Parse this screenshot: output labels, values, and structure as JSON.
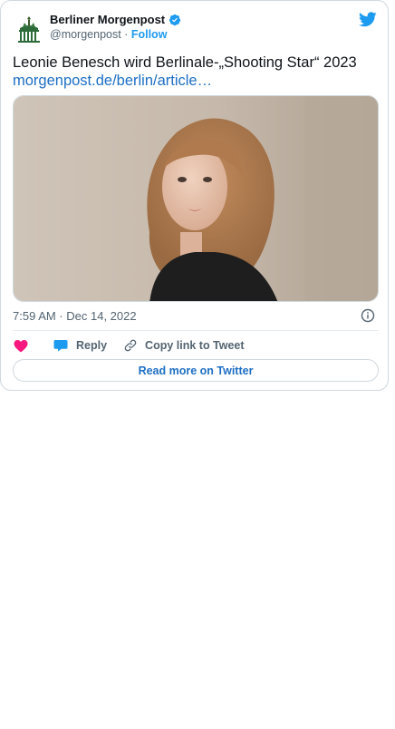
{
  "tweet": {
    "author_name": "Berliner Morgenpost",
    "handle": "@morgenpost",
    "separator": "·",
    "follow_label": "Follow",
    "text": "Leonie Benesch wird Berlinale-„Shooting Star“ 2023",
    "link_text": "morgenpost.de/berlin/article…",
    "timestamp": "7:59 AM · Dec 14, 2022"
  },
  "actions": {
    "like_label": "",
    "reply_label": "Reply",
    "copy_label": "Copy link to Tweet"
  },
  "read_more_label": "Read more on Twitter",
  "colors": {
    "twitter_blue": "#1d9bf0",
    "link_blue": "#1d6fc4",
    "heart_pink": "#f91880",
    "muted_text": "#536471",
    "border": "#cfd9de"
  },
  "icons": [
    "berliner-morgenpost-logo-icon",
    "verified-badge-icon",
    "twitter-bird-icon",
    "info-icon",
    "heart-icon",
    "reply-bubble-icon",
    "link-icon"
  ]
}
